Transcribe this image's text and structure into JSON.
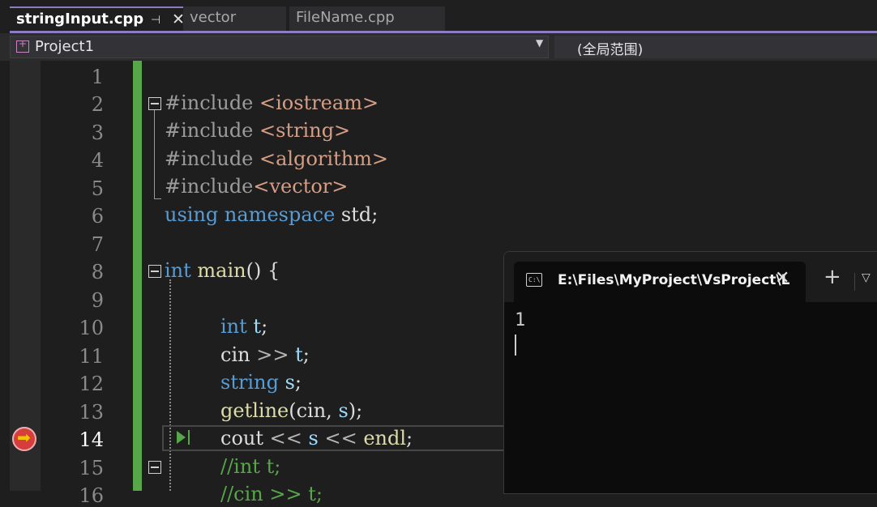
{
  "tabs": [
    {
      "label": "stringInput.cpp",
      "active": true
    },
    {
      "label": "vector",
      "active": false
    },
    {
      "label": "FileName.cpp",
      "active": false
    }
  ],
  "tab_icons": {
    "pin": "⊣",
    "close": "✕"
  },
  "navbar": {
    "project": "Project1",
    "scope": "(全局范围)"
  },
  "editor": {
    "current_line": 14,
    "lines": [
      {
        "num": "1"
      },
      {
        "num": "2"
      },
      {
        "num": "3"
      },
      {
        "num": "4"
      },
      {
        "num": "5"
      },
      {
        "num": "6"
      },
      {
        "num": "7"
      },
      {
        "num": "8"
      },
      {
        "num": "9"
      },
      {
        "num": "10"
      },
      {
        "num": "11"
      },
      {
        "num": "12"
      },
      {
        "num": "13"
      },
      {
        "num": "14"
      },
      {
        "num": "15"
      },
      {
        "num": "16"
      }
    ],
    "code": {
      "l2_pp": "#include ",
      "l2_str": "<iostream>",
      "l3_pp": "#include ",
      "l3_str": "<string>",
      "l4_pp": "#include ",
      "l4_str": "<algorithm>",
      "l5_pp": "#include",
      "l5_str": "<vector>",
      "l6_kw1": "using",
      "l6_kw2": "namespace",
      "l6_plain": " std;",
      "l8_kw": "int",
      "l8_fn": "main",
      "l8_rest": "() {",
      "l10_kw": "int",
      "l10_var": "t",
      "l10_rest": ";",
      "l11_a": "cin ",
      "l11_op": ">>",
      "l11_var": "t",
      "l11_rest": ";",
      "l12_kw": "string",
      "l12_var": "s",
      "l12_rest": ";",
      "l13_fn": "getline",
      "l13_a": "(cin, ",
      "l13_var": "s",
      "l13_rest": ");",
      "l14_a": "cout ",
      "l14_op1": "<<",
      "l14_var": "s",
      "l14_op2": "<<",
      "l14_fn": "endl",
      "l14_rest": ";",
      "l15_cm": "//int t;",
      "l16_cm": "//cin >> t;"
    }
  },
  "terminal": {
    "title": "E:\\Files\\MyProject\\VsProject\\L",
    "icon_text": "C:\\",
    "close": "✕",
    "new_tab": "+",
    "dropdown": "⌄",
    "output": "1"
  }
}
